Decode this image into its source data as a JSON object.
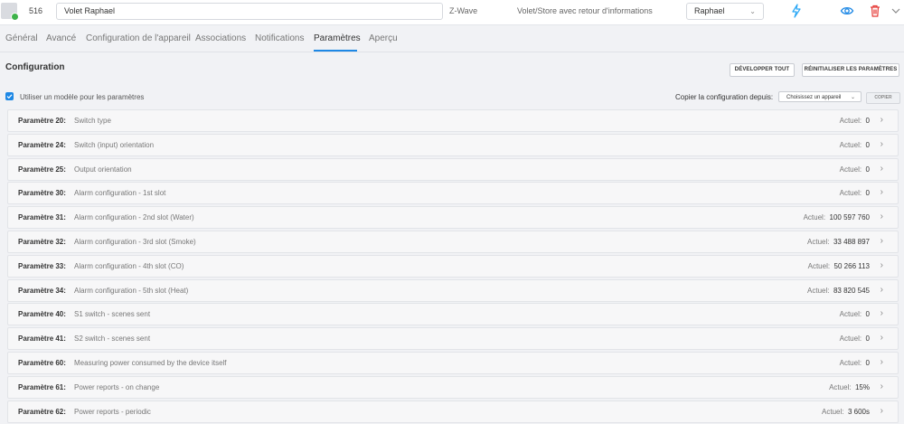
{
  "device": {
    "id": "516",
    "name": "Volet Raphael",
    "protocol": "Z-Wave",
    "type": "Volet/Store avec retour d'informations",
    "room": "Raphael",
    "colors": {
      "action_blue": "#2aa7f5",
      "eye_blue": "#1e88e5",
      "delete_red": "#e53935",
      "status_green": "#3eb34a"
    },
    "icons": [
      "device-thumbnail-icon",
      "status-ok-icon",
      "lightning-icon",
      "eye-icon",
      "trash-icon",
      "chevron-down-icon"
    ]
  },
  "tabs": [
    "Général",
    "Avancé",
    "Configuration de l'appareil",
    "Associations",
    "Notifications",
    "Paramètres",
    "Aperçu"
  ],
  "active_tab": "Paramètres",
  "config": {
    "title": "Configuration",
    "expand_all": "DÉVELOPPER TOUT",
    "reset_params": "RÉINITIALISER LES PARAMÈTRES",
    "use_template_label": "Utiliser un modèle pour les paramètres",
    "use_template_checked": true,
    "copy_from_label": "Copier la configuration depuis:",
    "copy_from_value": "Choisissez un appareil",
    "copy_button": "COPIER",
    "current_label": "Actuel:"
  },
  "parameters": [
    {
      "num": "Paramètre 20:",
      "desc": "Switch type",
      "value": "0"
    },
    {
      "num": "Paramètre 24:",
      "desc": "Switch (input) orientation",
      "value": "0"
    },
    {
      "num": "Paramètre 25:",
      "desc": "Output orientation",
      "value": "0"
    },
    {
      "num": "Paramètre 30:",
      "desc": "Alarm configuration - 1st slot",
      "value": "0"
    },
    {
      "num": "Paramètre 31:",
      "desc": "Alarm configuration - 2nd slot (Water)",
      "value": "100 597 760"
    },
    {
      "num": "Paramètre 32:",
      "desc": "Alarm configuration - 3rd slot (Smoke)",
      "value": "33 488 897"
    },
    {
      "num": "Paramètre 33:",
      "desc": "Alarm configuration - 4th slot (CO)",
      "value": "50 266 113"
    },
    {
      "num": "Paramètre 34:",
      "desc": "Alarm configuration - 5th slot (Heat)",
      "value": "83 820 545"
    },
    {
      "num": "Paramètre 40:",
      "desc": "S1 switch - scenes sent",
      "value": "0"
    },
    {
      "num": "Paramètre 41:",
      "desc": "S2 switch - scenes sent",
      "value": "0"
    },
    {
      "num": "Paramètre 60:",
      "desc": "Measuring power consumed by the device itself",
      "value": "0"
    },
    {
      "num": "Paramètre 61:",
      "desc": "Power reports - on change",
      "value": "15%"
    },
    {
      "num": "Paramètre 62:",
      "desc": "Power reports - periodic",
      "value": "3 600s"
    }
  ]
}
